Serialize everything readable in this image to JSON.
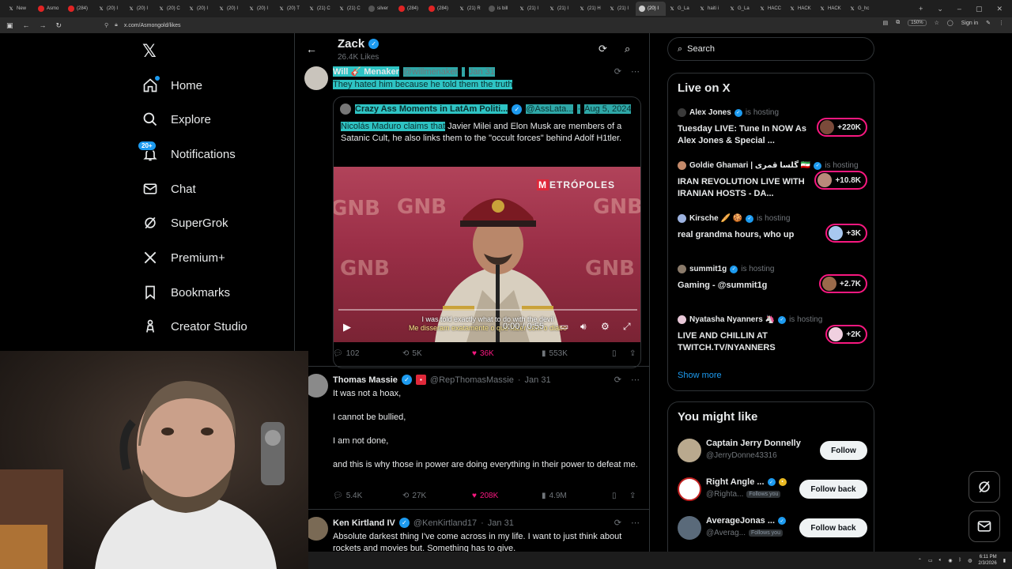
{
  "browser": {
    "tabs": [
      {
        "label": "New",
        "icon": "x"
      },
      {
        "label": "Asmo",
        "icon": "yt"
      },
      {
        "label": "(284)",
        "icon": "yt"
      },
      {
        "label": "(20) I",
        "icon": "x"
      },
      {
        "label": "(20) I",
        "icon": "x"
      },
      {
        "label": "(20) C",
        "icon": "x"
      },
      {
        "label": "(20) I",
        "icon": "x"
      },
      {
        "label": "(20) I",
        "icon": "x"
      },
      {
        "label": "(20) I",
        "icon": "x"
      },
      {
        "label": "(20) T",
        "icon": "x"
      },
      {
        "label": "(21) C",
        "icon": "x"
      },
      {
        "label": "(21) C",
        "icon": "x"
      },
      {
        "label": "silver",
        "icon": "gm"
      },
      {
        "label": "(284)",
        "icon": "yt"
      },
      {
        "label": "(284)",
        "icon": "yt"
      },
      {
        "label": "(21) R",
        "icon": "x"
      },
      {
        "label": "is bill",
        "icon": "gm"
      },
      {
        "label": "(21) I",
        "icon": "x"
      },
      {
        "label": "(21) I",
        "icon": "x"
      },
      {
        "label": "(21) H",
        "icon": "x"
      },
      {
        "label": "(21) I",
        "icon": "x"
      },
      {
        "label": "(20) I",
        "icon": "x2"
      },
      {
        "label": "G_La",
        "icon": "x"
      },
      {
        "label": "haiti i",
        "icon": "x"
      },
      {
        "label": "G_La",
        "icon": "x"
      },
      {
        "label": "HACC",
        "icon": "x"
      },
      {
        "label": "HACK",
        "icon": "x"
      },
      {
        "label": "HACK",
        "icon": "x"
      },
      {
        "label": "G_hc",
        "icon": "x"
      }
    ],
    "active_tab_index": 21,
    "url": "x.com/Asmongold/likes",
    "zoom": "150%",
    "signin": "Sign in"
  },
  "nav": {
    "items": [
      {
        "label": "Home",
        "icon": "home-icon"
      },
      {
        "label": "Explore",
        "icon": "search-icon"
      },
      {
        "label": "Notifications",
        "icon": "bell-icon",
        "badge": "20+"
      },
      {
        "label": "Chat",
        "icon": "mail-icon"
      },
      {
        "label": "SuperGrok",
        "icon": "grok-icon"
      },
      {
        "label": "Premium+",
        "icon": "x-icon"
      },
      {
        "label": "Bookmarks",
        "icon": "bookmark-icon"
      },
      {
        "label": "Creator Studio",
        "icon": "creator-icon"
      }
    ]
  },
  "profile": {
    "name": "Zack",
    "likes": "26.4K Likes"
  },
  "tweets": [
    {
      "name": "Will 🎸 Menaker",
      "handle": "@willmenaker",
      "dot": "·",
      "date": "Jan 31",
      "text": "They hated him because he told them the truth",
      "quote": {
        "name": "Crazy Ass Moments in LatAm Politi...",
        "handle": "@AssLata...",
        "dot": "·",
        "date": "Aug 5, 2024",
        "text_hl": "Nicolás Maduro claims that",
        "text_rest": " Javier Milei and Elon Musk are members of a Satanic Cult, he also links them to the \"occult forces\" behind Adolf H1tler.",
        "video": {
          "watermark": "METRÓPOLES",
          "wm_first": "M",
          "wm_rest": "ETRÓPOLES",
          "bg_text": "GNB",
          "sub1": "I was told exactly what to do with the devil",
          "sub2": "Me disseram exatamente o que fazer com o diabo",
          "time": "0:00 / 0:55"
        }
      },
      "replies": "102",
      "reposts": "5K",
      "likes": "36K",
      "views": "553K"
    },
    {
      "name": "Thomas Massie",
      "handle": "@RepThomasMassie",
      "dot": "·",
      "date": "Jan 31",
      "lines": [
        "It was not a hoax,",
        "I cannot be bullied,",
        "I am not done,",
        "and this is why those in power are doing everything in their power to defeat me."
      ],
      "replies": "5.4K",
      "reposts": "27K",
      "likes": "208K",
      "views": "4.9M"
    },
    {
      "name": "Ken Kirtland IV",
      "handle": "@KenKirtland17",
      "dot": "·",
      "date": "Jan 31",
      "text": "Absolute darkest thing I've come across in my life. I want to just think about rockets and movies but. Something has to give."
    }
  ],
  "sidebar": {
    "search_placeholder": "Search",
    "live": {
      "title": "Live on X",
      "hosting": "is hosting",
      "items": [
        {
          "host": "Alex Jones",
          "title": "Tuesday LIVE: Tune In NOW As Alex Jones & Special ...",
          "count": "+220K"
        },
        {
          "host": "Goldie Ghamari | گلسا قمری 🇮🇷",
          "title": "IRAN REVOLUTION LIVE WITH IRANIAN HOSTS - DA...",
          "count": "+10.8K"
        },
        {
          "host": "Kirsche 🥖 🍪",
          "title": "real grandma hours, who up",
          "count": "+3K"
        },
        {
          "host": "summit1g",
          "title": "Gaming - @summit1g",
          "count": "+2.7K"
        },
        {
          "host": "Nyatasha Nyanners 🦄",
          "title": "LIVE AND CHILLIN AT TWITCH.TV/NYANNERS",
          "count": "+2K"
        }
      ],
      "show_more": "Show more"
    },
    "suggest": {
      "title": "You might like",
      "items": [
        {
          "name": "Captain Jerry Donnelly",
          "handle": "@JerryDonne43316",
          "follows_you": "",
          "button": "Follow"
        },
        {
          "name": "Right Angle ...",
          "handle": "@Righta...",
          "follows_you": "Follows you",
          "button": "Follow back"
        },
        {
          "name": "AverageJonas ...",
          "handle": "@Averag...",
          "follows_you": "Follows you",
          "button": "Follow back"
        }
      ]
    }
  },
  "taskbar": {
    "time": "6:11 PM",
    "date": "2/3/2026"
  },
  "colors": {
    "accent": "#1d9bf0",
    "like": "#f91880",
    "highlight": "#2ec4c4"
  }
}
